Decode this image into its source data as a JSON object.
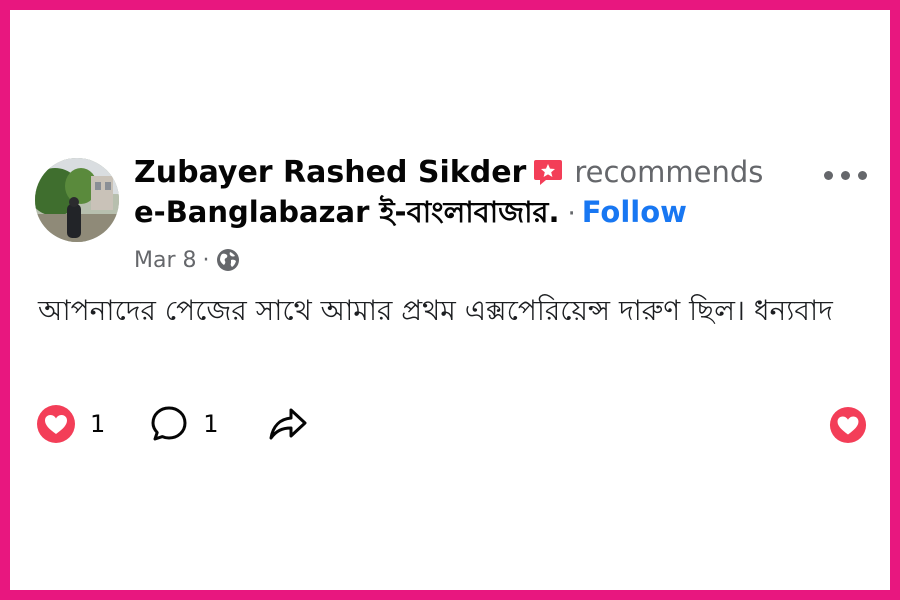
{
  "post": {
    "author": "Zubayer Rashed Sikder",
    "action": "recommends",
    "page_name": "e-Banglabazar ই-বাংলাবাজার.",
    "separator": "·",
    "follow_label": "Follow",
    "date": "Mar 8",
    "meta_separator": "·",
    "body": "আপনাদের পেজের সাথে আমার প্রথম এক্সপেরিয়েন্স দারুণ ছিল। ধন্যবাদ",
    "reaction_count": "1",
    "comment_count": "1"
  },
  "icons": {
    "recommend_badge": "recommend-star-icon",
    "audience": "globe-icon",
    "more": "more-options-icon",
    "reaction": "heart-reaction-icon",
    "comment": "comment-icon",
    "share": "share-icon"
  },
  "colors": {
    "frame": "#e8177f",
    "follow": "#1877f2",
    "heart": "#f33e58",
    "secondary_text": "#65676b"
  }
}
